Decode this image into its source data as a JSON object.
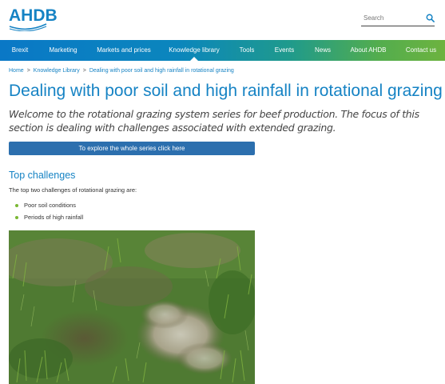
{
  "header": {
    "logo_text": "AHDB",
    "search": {
      "placeholder": "Search"
    }
  },
  "nav": {
    "items": [
      {
        "label": "Brexit"
      },
      {
        "label": "Marketing"
      },
      {
        "label": "Markets and prices"
      },
      {
        "label": "Knowledge library",
        "active": true
      },
      {
        "label": "Tools"
      },
      {
        "label": "Events"
      },
      {
        "label": "News"
      },
      {
        "label": "About AHDB"
      },
      {
        "label": "Contact us"
      }
    ]
  },
  "breadcrumb": {
    "items": [
      {
        "label": "Home"
      },
      {
        "label": "Knowledge Library"
      },
      {
        "label": "Dealing with poor soil and high rainfall in rotational grazing"
      }
    ],
    "separator": ">"
  },
  "main": {
    "title": "Dealing with poor soil and high rainfall in rotational grazing",
    "intro": "Welcome to the rotational grazing system series for beef production. The focus of this section is dealing with challenges associated with extended grazing.",
    "series_button": "To explore the whole series click here",
    "section_heading": "Top challenges",
    "section_text": "The top two challenges of rotational grazing are:",
    "challenges": [
      "Poor soil conditions",
      "Periods of high rainfall"
    ]
  },
  "colors": {
    "brand_blue": "#1683c4",
    "button_blue": "#2c6fae",
    "bullet_green": "#7ab833"
  },
  "icons": {
    "search": "search-icon",
    "nav_active_marker": "caret-up-icon"
  }
}
